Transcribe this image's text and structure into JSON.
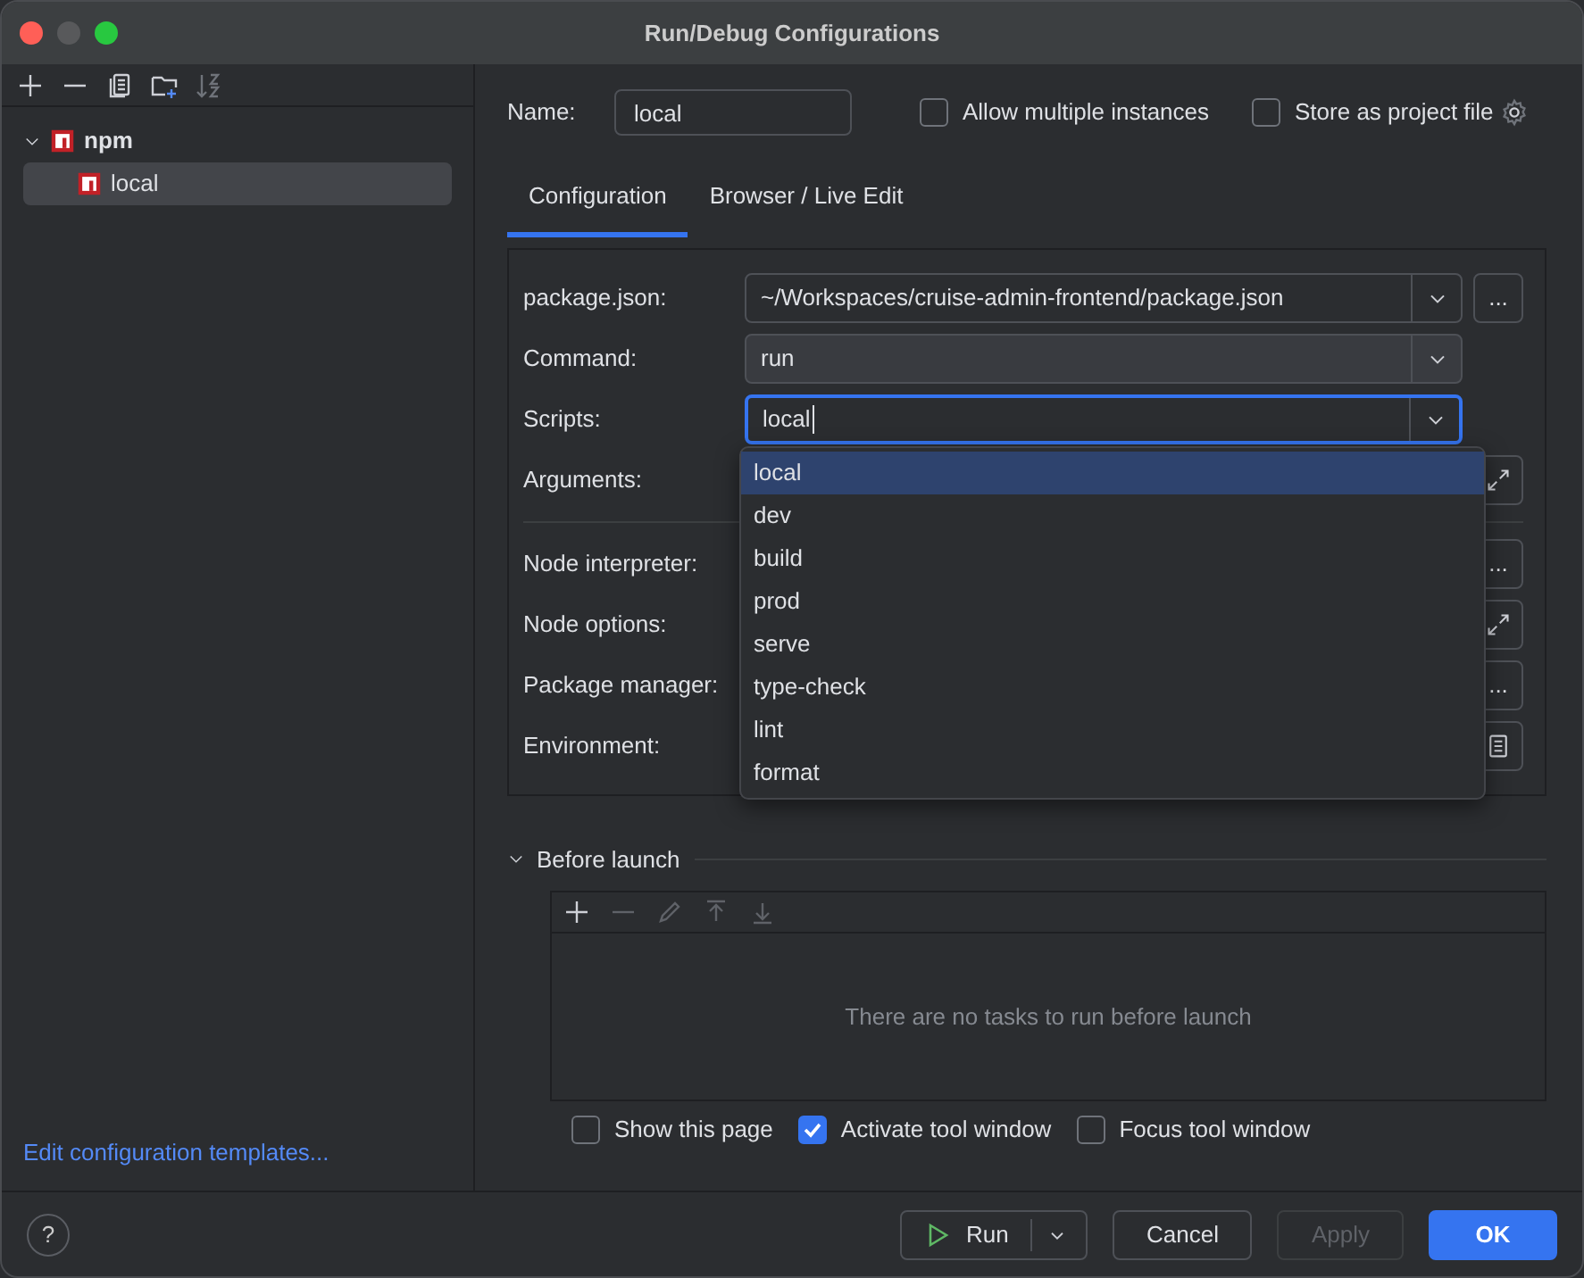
{
  "window": {
    "title": "Run/Debug Configurations"
  },
  "sidebar": {
    "tree": [
      {
        "label": "npm",
        "expanded": true,
        "selected": false,
        "children": [
          {
            "label": "local",
            "selected": true
          }
        ]
      }
    ],
    "link": "Edit configuration templates..."
  },
  "name": {
    "label": "Name:",
    "value": "local"
  },
  "options": [
    {
      "label": "Allow multiple instances",
      "checked": false
    },
    {
      "label": "Store as project file",
      "checked": false
    }
  ],
  "tabs": [
    {
      "label": "Configuration",
      "selected": true
    },
    {
      "label": "Browser / Live Edit",
      "selected": false
    }
  ],
  "field_groups": [
    [
      {
        "label": "package.json:",
        "kind": "combo",
        "value": "~/Workspaces/cruise-admin-frontend/package.json",
        "focused": false,
        "side": {
          "kind": "more",
          "text": "..."
        }
      },
      {
        "label": "Command:",
        "kind": "combo",
        "value": "run",
        "focused": false
      },
      {
        "label": "Scripts:",
        "kind": "combo",
        "value": "local",
        "focused": true
      },
      {
        "label": "Arguments:",
        "kind": "covered",
        "side": {
          "kind": "expand"
        }
      }
    ],
    [
      {
        "label": "Node interpreter:",
        "kind": "covered",
        "side": {
          "kind": "more",
          "text": "..."
        }
      },
      {
        "label": "Node options:",
        "kind": "covered",
        "side": {
          "kind": "expand"
        }
      },
      {
        "label": "Package manager:",
        "kind": "covered",
        "side": {
          "kind": "more",
          "text": "..."
        }
      },
      {
        "label": "Environment:",
        "kind": "covered",
        "side": {
          "kind": "doc"
        }
      }
    ]
  ],
  "scripts_dropdown": [
    {
      "label": "local",
      "selected": true
    },
    {
      "label": "dev",
      "selected": false
    },
    {
      "label": "build",
      "selected": false
    },
    {
      "label": "prod",
      "selected": false
    },
    {
      "label": "serve",
      "selected": false
    },
    {
      "label": "type-check",
      "selected": false
    },
    {
      "label": "lint",
      "selected": false
    },
    {
      "label": "format",
      "selected": false
    }
  ],
  "before_launch": {
    "title": "Before launch",
    "expanded": true,
    "empty_text": "There are no tasks to run before launch"
  },
  "launch_options": [
    {
      "label": "Show this page",
      "checked": false
    },
    {
      "label": "Activate tool window",
      "checked": true
    },
    {
      "label": "Focus tool window",
      "checked": false
    }
  ],
  "footer": {
    "help": "?",
    "buttons": [
      {
        "label": "Run",
        "kind": "split"
      },
      {
        "label": "Cancel",
        "kind": "normal"
      },
      {
        "label": "Apply",
        "kind": "disabled"
      },
      {
        "label": "OK",
        "kind": "primary"
      }
    ]
  }
}
